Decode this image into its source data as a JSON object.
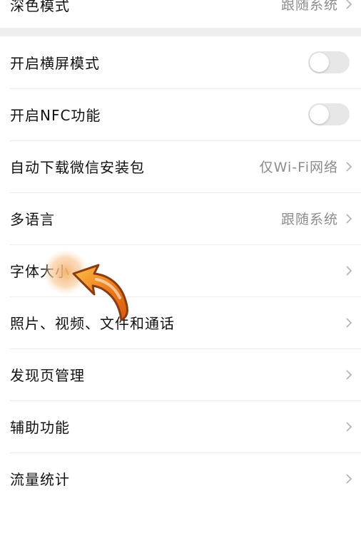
{
  "settings": {
    "dark_mode": {
      "title": "深色模式",
      "value": "跟随系统"
    },
    "items": [
      {
        "title": "开启横屏模式",
        "type": "toggle",
        "on": false
      },
      {
        "title": "开启NFC功能",
        "type": "toggle",
        "on": false
      },
      {
        "title": "自动下载微信安装包",
        "type": "value",
        "value": "仅Wi-Fi网络"
      },
      {
        "title": "多语言",
        "type": "value",
        "value": "跟随系统"
      },
      {
        "title": "字体大小",
        "type": "chevron"
      },
      {
        "title": "照片、视频、文件和通话",
        "type": "chevron"
      },
      {
        "title": "发现页管理",
        "type": "chevron"
      },
      {
        "title": "辅助功能",
        "type": "chevron"
      },
      {
        "title": "流量统计",
        "type": "chevron"
      }
    ]
  },
  "icons": {
    "chevron": "chevron-right-icon",
    "pointer": "arrow-pointer-icon"
  },
  "colors": {
    "text": "#111111",
    "secondary": "#8c8c8c",
    "divider": "#ececec",
    "section_gap": "#eeeeee",
    "toggle_off": "#e7e7e7",
    "cursor_orange": "#f07a1a"
  }
}
